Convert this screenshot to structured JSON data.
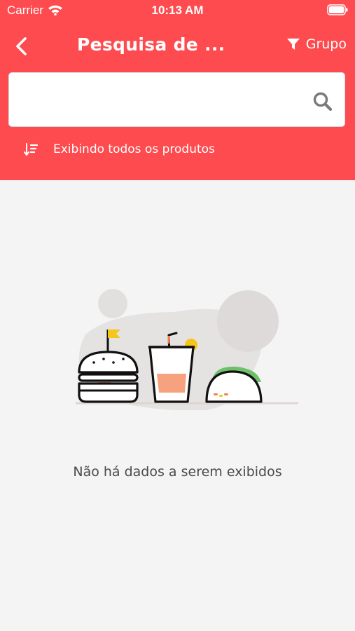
{
  "status_bar": {
    "carrier": "Carrier",
    "time": "10:13 AM"
  },
  "nav": {
    "title": "Pesquisa de ...",
    "group_label": "Grupo"
  },
  "search": {
    "value": "",
    "placeholder": ""
  },
  "sort": {
    "label": "Exibindo todos os produtos"
  },
  "empty_state": {
    "message": "Não há dados a serem exibidos"
  },
  "colors": {
    "header_bg": "#fd4b4f",
    "page_bg": "#f4f4f4",
    "text_muted": "#4a4a4a"
  },
  "icons": [
    "wifi-icon",
    "battery-icon",
    "back-chevron-icon",
    "filter-funnel-icon",
    "search-icon",
    "sort-descending-icon",
    "burger-icon",
    "drink-cup-icon",
    "taco-icon"
  ]
}
